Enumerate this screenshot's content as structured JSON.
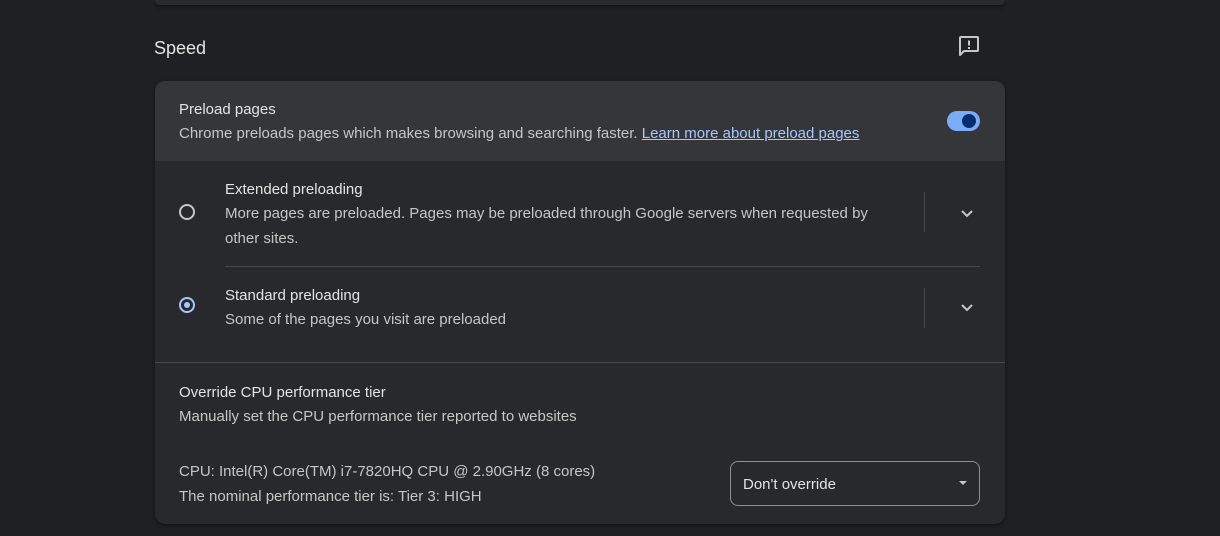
{
  "section": {
    "title": "Speed",
    "feedback_icon": "feedback-icon"
  },
  "preload": {
    "title": "Preload pages",
    "description": "Chrome preloads pages which makes browsing and searching faster.",
    "learn_more": "Learn more about preload pages",
    "enabled": true
  },
  "options": [
    {
      "title": "Extended preloading",
      "description": "More pages are preloaded. Pages may be preloaded through Google servers when requested by other sites.",
      "selected": false
    },
    {
      "title": "Standard preloading",
      "description": "Some of the pages you visit are preloaded",
      "selected": true
    }
  ],
  "cpu": {
    "title": "Override CPU performance tier",
    "description": "Manually set the CPU performance tier reported to websites",
    "cpu_info": "CPU: Intel(R) Core(TM) i7-7820HQ CPU @ 2.90GHz (8 cores)",
    "tier_info": "The nominal performance tier is: Tier 3: HIGH",
    "select_value": "Don't override"
  },
  "colors": {
    "background": "#1f2023",
    "card": "#28292c",
    "highlight_row": "#35363a",
    "accent": "#a8c7fa",
    "toggle_track": "#7cacf8",
    "toggle_knob": "#062e6f"
  }
}
